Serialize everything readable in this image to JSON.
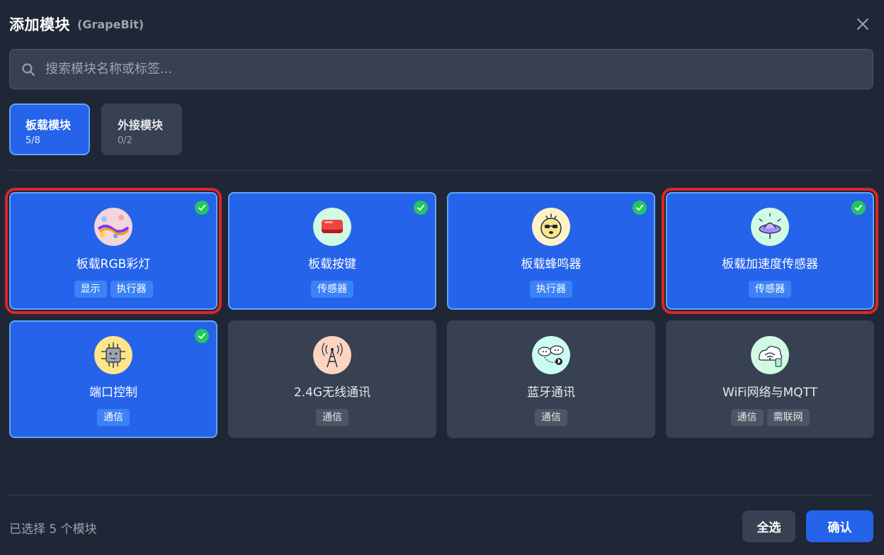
{
  "header": {
    "title": "添加模块",
    "subtitle": "(GrapeBit)"
  },
  "search": {
    "placeholder": "搜索模块名称或标签..."
  },
  "tabs": [
    {
      "label": "板载模块",
      "count": "5/8",
      "active": true
    },
    {
      "label": "外接模块",
      "count": "0/2",
      "active": false
    }
  ],
  "modules": [
    {
      "name": "板载RGB彩灯",
      "tags": [
        "显示",
        "执行器"
      ],
      "selected": true,
      "highlighted": true,
      "icon": "rgb-light-icon"
    },
    {
      "name": "板载按键",
      "tags": [
        "传感器"
      ],
      "selected": true,
      "highlighted": false,
      "icon": "button-key-icon"
    },
    {
      "name": "板载蜂鸣器",
      "tags": [
        "执行器"
      ],
      "selected": true,
      "highlighted": false,
      "icon": "buzzer-icon"
    },
    {
      "name": "板载加速度传感器",
      "tags": [
        "传感器"
      ],
      "selected": true,
      "highlighted": true,
      "icon": "accelerometer-icon"
    },
    {
      "name": "端口控制",
      "tags": [
        "通信"
      ],
      "selected": true,
      "highlighted": false,
      "icon": "port-chip-icon"
    },
    {
      "name": "2.4G无线通讯",
      "tags": [
        "通信"
      ],
      "selected": false,
      "highlighted": false,
      "icon": "radio-tower-icon"
    },
    {
      "name": "蓝牙通讯",
      "tags": [
        "通信"
      ],
      "selected": false,
      "highlighted": false,
      "icon": "bluetooth-cloud-icon"
    },
    {
      "name": "WiFi网络与MQTT",
      "tags": [
        "通信",
        "需联网"
      ],
      "selected": false,
      "highlighted": false,
      "icon": "wifi-cloud-icon"
    }
  ],
  "footer": {
    "status": "已选择 5 个模块",
    "select_all_label": "全选",
    "confirm_label": "确认"
  },
  "colors": {
    "background": "#1f2736",
    "accent": "#2563eb",
    "check": "#22c55e",
    "highlight": "#dc2626"
  }
}
